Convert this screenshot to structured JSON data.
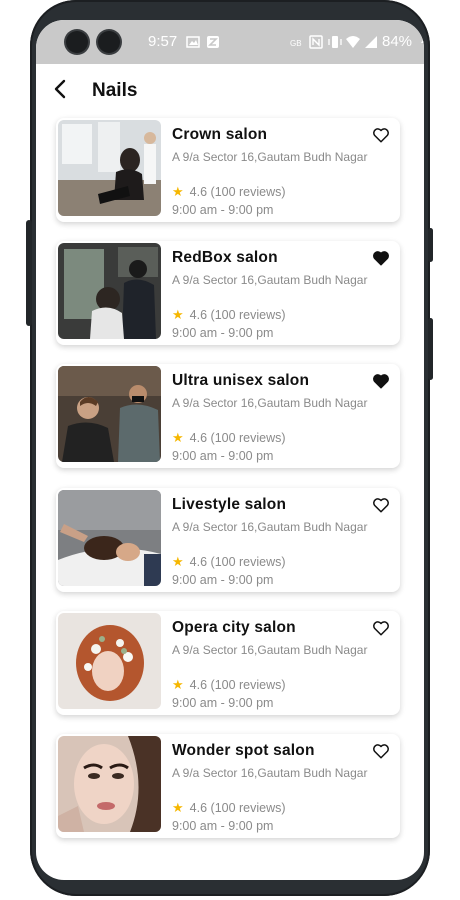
{
  "status": {
    "time": "9:57",
    "battery": "84%"
  },
  "header": {
    "title": "Nails"
  },
  "salons": [
    {
      "name": "Crown salon",
      "address": "A 9/a Sector 16,Gautam Budh Nagar",
      "rating": "4.6",
      "reviews": "(100 reviews)",
      "hours": "9:00 am - 9:00 pm",
      "favorite": false
    },
    {
      "name": "RedBox salon",
      "address": "A 9/a Sector 16,Gautam Budh Nagar",
      "rating": "4.6",
      "reviews": "(100 reviews)",
      "hours": "9:00 am - 9:00 pm",
      "favorite": true
    },
    {
      "name": "Ultra unisex salon",
      "address": "A 9/a Sector 16,Gautam Budh Nagar",
      "rating": "4.6",
      "reviews": "(100 reviews)",
      "hours": "9:00 am - 9:00 pm",
      "favorite": true
    },
    {
      "name": "Livestyle salon",
      "address": "A 9/a Sector 16,Gautam Budh Nagar",
      "rating": "4.6",
      "reviews": "(100 reviews)",
      "hours": "9:00 am - 9:00 pm",
      "favorite": false
    },
    {
      "name": "Opera city salon",
      "address": "A 9/a Sector 16,Gautam Budh Nagar",
      "rating": "4.6",
      "reviews": "(100 reviews)",
      "hours": "9:00 am - 9:00 pm",
      "favorite": false
    },
    {
      "name": "Wonder spot salon",
      "address": "A 9/a Sector 16,Gautam Budh Nagar",
      "rating": "4.6",
      "reviews": "(100 reviews)",
      "hours": "9:00 am - 9:00 pm",
      "favorite": false
    }
  ],
  "colors": {
    "star": "#f6b700",
    "statusbar": "#c9c9c9",
    "text_secondary": "#8a8a8a"
  },
  "icons": {
    "back": "chevron-left-icon",
    "favorite": "heart-icon",
    "rating": "star-icon"
  }
}
